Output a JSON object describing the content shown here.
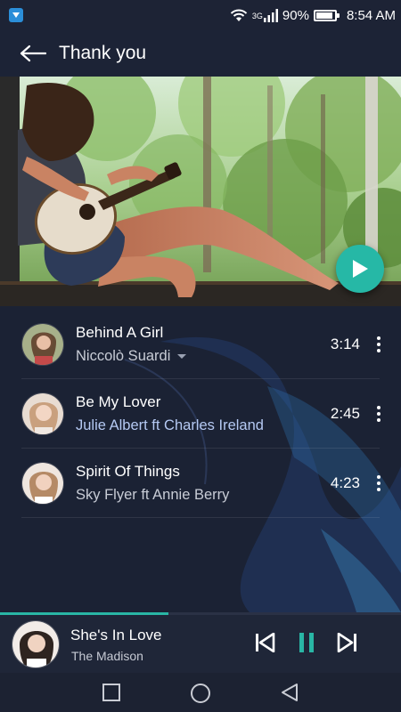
{
  "status_bar": {
    "network": "3G",
    "battery": "90%",
    "battery_level": 0.9,
    "time": "8:54 AM"
  },
  "header": {
    "title": "Thank you"
  },
  "tracks": [
    {
      "title": "Behind A Girl",
      "artist": "Niccolò Suardi",
      "duration": "3:14"
    },
    {
      "title": "Be My Lover",
      "artist": "Julie Albert ft Charles Ireland",
      "duration": "2:45"
    },
    {
      "title": "Spirit Of Things",
      "artist": "Sky Flyer ft Annie Berry",
      "duration": "4:23"
    }
  ],
  "now_playing": {
    "title": "She's In Love",
    "artist": "The Madison",
    "progress": 0.42
  },
  "icons": {
    "back": "back-arrow-icon",
    "play": "play-icon",
    "more": "more-vertical-icon",
    "previous": "skip-previous-icon",
    "pause": "pause-icon",
    "next": "skip-next-icon",
    "nav_recents": "square-icon",
    "nav_home": "circle-icon",
    "nav_back": "triangle-back-icon"
  },
  "colors": {
    "accent": "#29b6a5",
    "background": "#1b2234",
    "artist_highlight": "#b5c9f3"
  }
}
